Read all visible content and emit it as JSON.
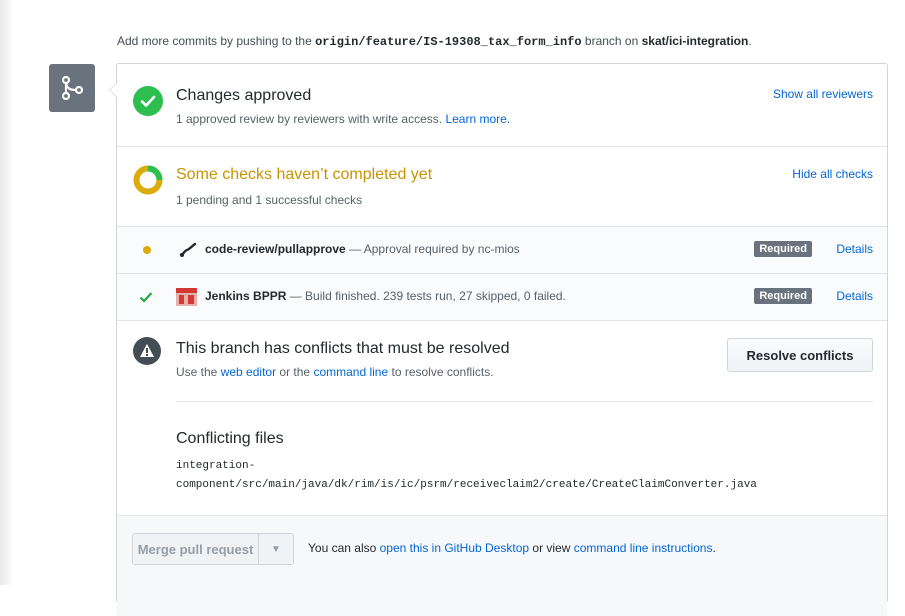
{
  "header": {
    "prefix": "Add more commits by pushing to the",
    "branch": "origin/feature/IS-19308_tax_form_info",
    "middle": "branch on",
    "repo": "skat/ici-integration",
    "suffix": "."
  },
  "approval": {
    "title": "Changes approved",
    "subtitle": "1 approved review by reviewers with write access.",
    "learn_more": "Learn more.",
    "show_reviewers": "Show all reviewers"
  },
  "checks": {
    "title": "Some checks haven’t completed yet",
    "subtitle": "1 pending and 1 successful checks",
    "hide_link": "Hide all checks",
    "items": [
      {
        "name": "code-review/pullapprove",
        "description": "— Approval required by nc-mios",
        "badge": "Required",
        "details": "Details",
        "status": "pending"
      },
      {
        "name": "Jenkins BPPR",
        "description": "— Build finished. 239 tests run, 27 skipped, 0 failed.",
        "badge": "Required",
        "details": "Details",
        "status": "success"
      }
    ]
  },
  "conflicts": {
    "title": "This branch has conflicts that must be resolved",
    "use_the": "Use the",
    "web_editor": "web editor",
    "or_the": "or the",
    "command_line": "command line",
    "to_resolve": "to resolve conflicts.",
    "resolve_button": "Resolve conflicts",
    "files_heading": "Conflicting files",
    "file_path_line1": "integration-",
    "file_path_line2": "component/src/main/java/dk/rim/is/ic/psrm/receiveclaim2/create/CreateClaimConverter.java"
  },
  "merge": {
    "button": "Merge pull request",
    "hint_prefix": "You can also",
    "desktop_link": "open this in GitHub Desktop",
    "hint_middle": "or view",
    "cli_link": "command line instructions",
    "hint_suffix": "."
  },
  "colors": {
    "success": "#2cbe4e",
    "pending": "#dbab09",
    "link": "#0366d6",
    "badge": "#6a737d",
    "muted": "#586069"
  }
}
